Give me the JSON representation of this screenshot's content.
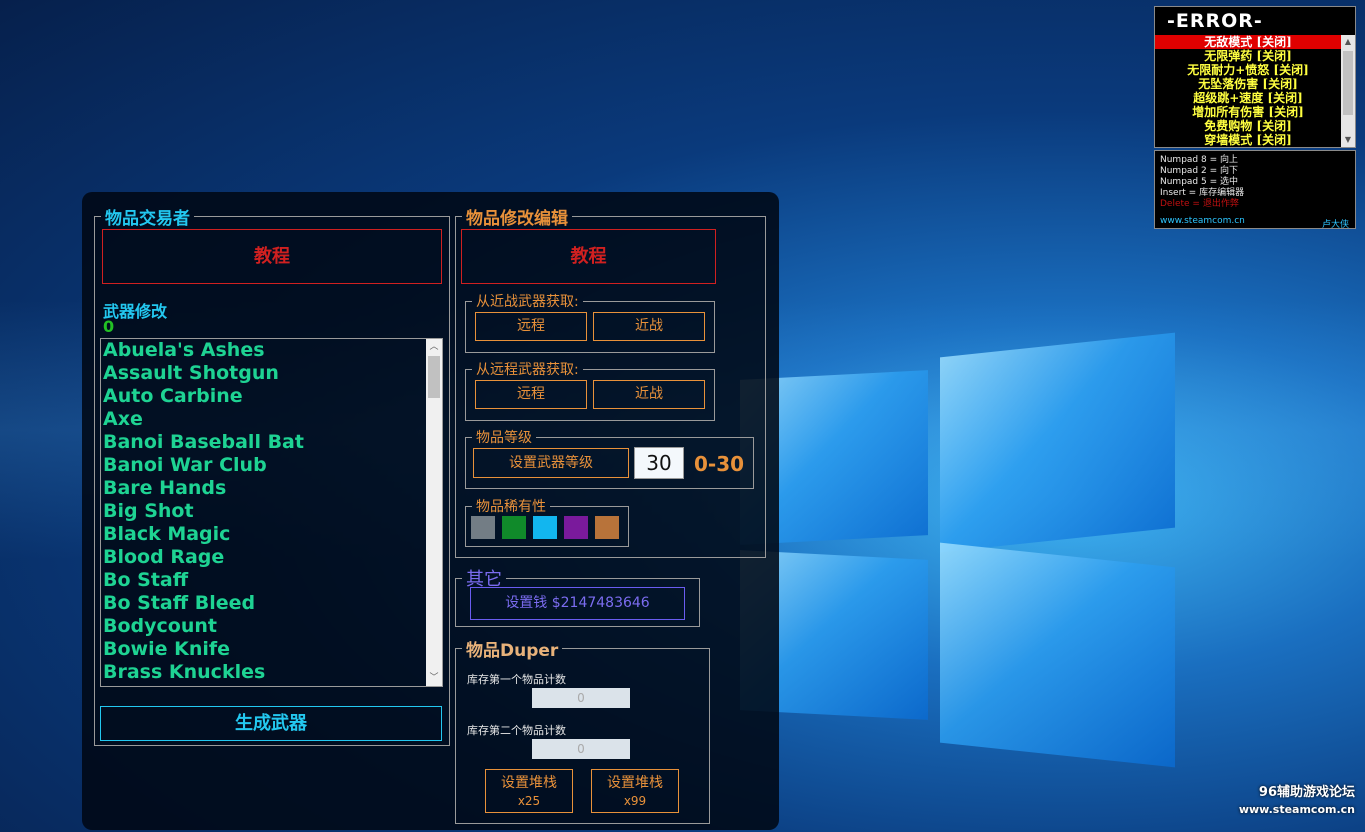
{
  "overlay": {
    "title": "-ERROR-",
    "items": [
      "无敌模式 [关闭]",
      "无限弹药 [关闭]",
      "无限耐力+愤怒 [关闭]",
      "无坠落伤害 [关闭]",
      "超级跳+速度 [关闭]",
      "增加所有伤害 [关闭]",
      "免费购物 [关闭]",
      "穿墙模式 [关闭]"
    ],
    "selected_index": 0,
    "help": [
      "Numpad 8 = 向上",
      "Numpad 2 = 向下",
      "Numpad 5 = 选中",
      "Insert = 库存编辑器"
    ],
    "help_red": "Delete = 退出作弊",
    "link": "www.steamcom.cn",
    "author": "卢大侠"
  },
  "item_trader": {
    "legend": "物品交易者",
    "tutorial_label": "教程",
    "weapon_mod_label": "武器修改",
    "selected_count": "0",
    "weapons": [
      "Abuela's Ashes",
      "Assault Shotgun",
      "Auto Carbine",
      "Axe",
      "Banoi Baseball Bat",
      "Banoi War Club",
      "Bare Hands",
      "Big Shot",
      "Black Magic",
      "Blood Rage",
      "Bo Staff",
      "Bo Staff Bleed",
      "Bodycount",
      "Bowie Knife",
      "Brass Knuckles"
    ],
    "generate_label": "生成武器"
  },
  "item_editor": {
    "legend": "物品修改编辑",
    "tutorial_label": "教程",
    "from_melee": {
      "legend": "从近战武器获取:",
      "ranged": "远程",
      "melee": "近战"
    },
    "from_ranged": {
      "legend": "从远程武器获取:",
      "ranged": "远程",
      "melee": "近战"
    },
    "level": {
      "legend": "物品等级",
      "button": "设置武器等级",
      "value": "30",
      "range": "0-30"
    },
    "rarity": {
      "legend": "物品稀有性",
      "colors": [
        "#737d85",
        "#108a2a",
        "#12b6ef",
        "#7a1a9c",
        "#b8733a"
      ]
    }
  },
  "other": {
    "legend": "其它",
    "money_button": "设置钱 $2147483646"
  },
  "duper": {
    "legend": "物品Duper",
    "first_label": "库存第一个物品计数",
    "first_value": "0",
    "second_label": "库存第二个物品计数",
    "second_value": "0",
    "stack1_label": "设置堆栈",
    "stack1_sub": "x25",
    "stack2_label": "设置堆栈",
    "stack2_sub": "x99"
  },
  "watermark": {
    "line1": "96辅助游戏论坛",
    "line2": "www.steamcom.cn"
  }
}
